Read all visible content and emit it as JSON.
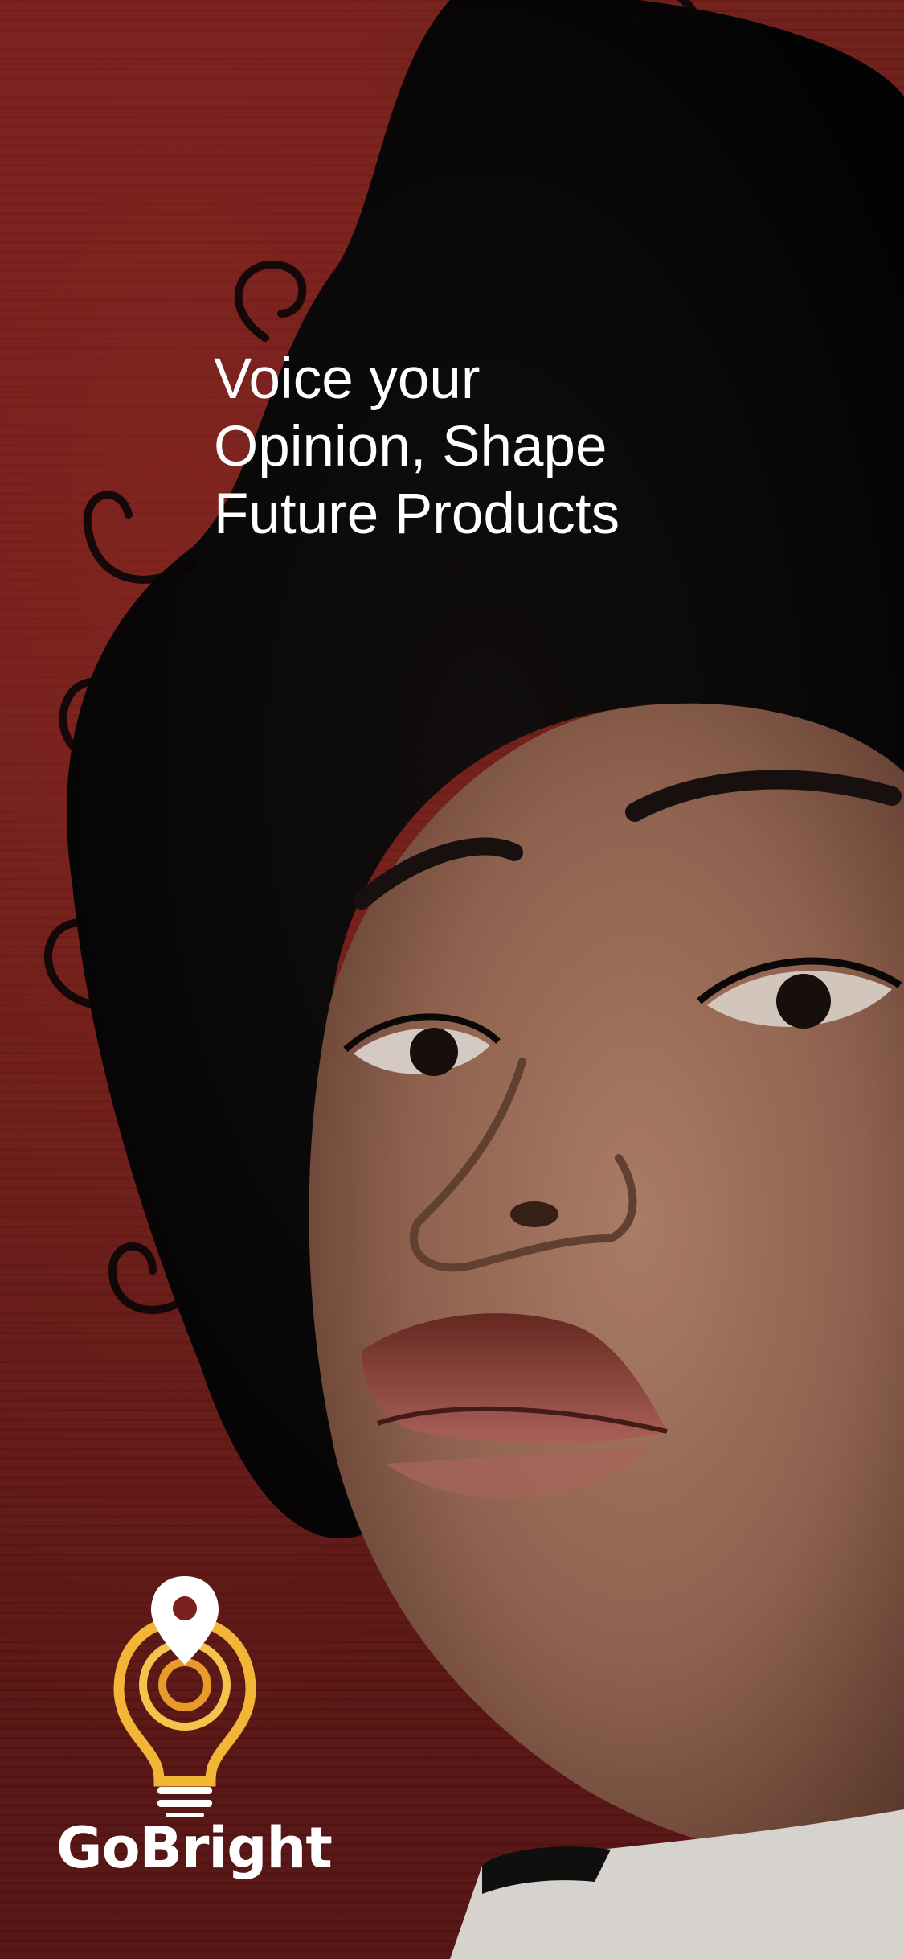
{
  "onboarding": {
    "headline_lines": [
      "Voice your",
      "Opinion, Shape",
      "Future Products"
    ]
  },
  "brand": {
    "name": "GoBright",
    "logo_icon": "lightbulb-location-pin-icon",
    "accent_color": "#f2b535",
    "accent_color_dark": "#e89a2a"
  },
  "background": {
    "description_color": "#6e1b18"
  }
}
